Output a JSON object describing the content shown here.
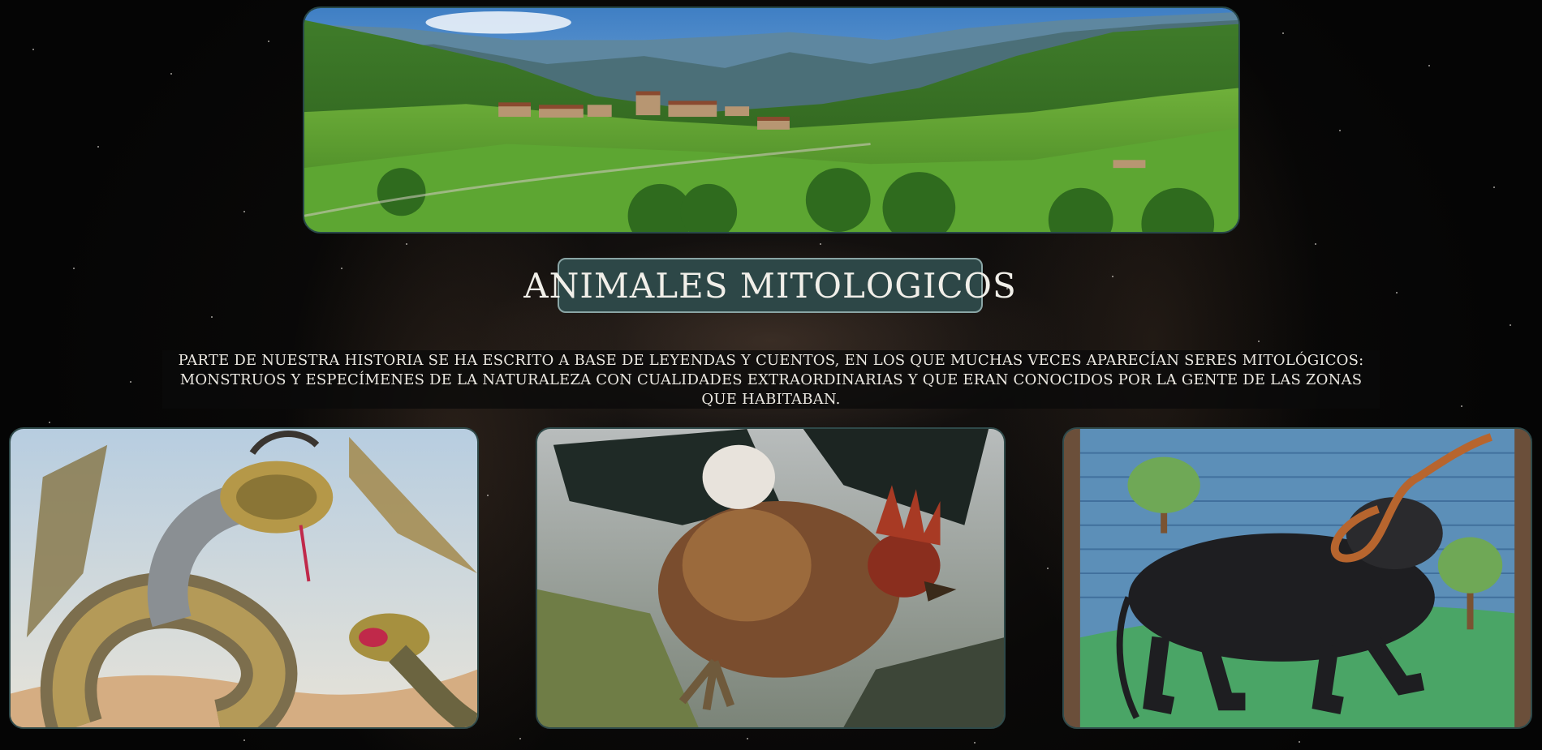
{
  "page": {
    "title": "ANIMALES MITOLOGICOS",
    "intro": "PARTE DE NUESTRA HISTORIA SE HA ESCRITO A BASE DE LEYENDAS Y CUENTOS, EN LOS QUE MUCHAS VECES APARECÍAN SERES MITOLÓGICOS: MONSTRUOS Y ESPECÍMENES DE LA NATURALEZA CON CUALIDADES EXTRAORDINARIAS Y QUE ERAN CONOCIDOS POR LA GENTE DE LAS ZONAS QUE HABITABAN."
  },
  "images": {
    "hero": "mountain-village-landscape",
    "card1": "two-headed-serpent-dragon",
    "card2": "rooster-winged-beast",
    "card3": "horned-black-beast-manuscript"
  },
  "colors": {
    "title_bg": "#2d4747",
    "title_border": "#8aa5a5",
    "text": "#f1efe9",
    "frame_border": "#2f4a4a",
    "background": "#0a0908"
  }
}
